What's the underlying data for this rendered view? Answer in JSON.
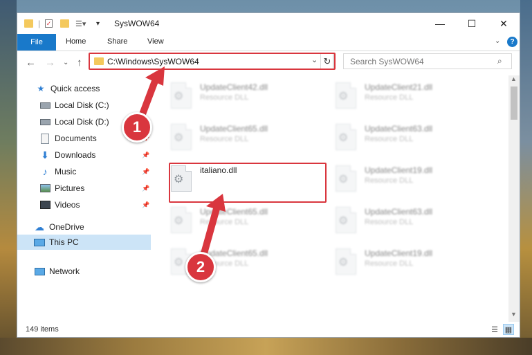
{
  "window": {
    "title": "SysWOW64",
    "controls": {
      "minimize": "—",
      "maximize": "☐",
      "close": "✕"
    }
  },
  "ribbon": {
    "file": "File",
    "tabs": [
      "Home",
      "Share",
      "View"
    ],
    "help": "?"
  },
  "address": {
    "path": "C:\\Windows\\SysWOW64",
    "search_placeholder": "Search SysWOW64"
  },
  "nav_pane": {
    "quick_access": "Quick access",
    "items": [
      {
        "label": "Local Disk (C:)",
        "icon": "drive-icon",
        "pinned": false
      },
      {
        "label": "Local Disk (D:)",
        "icon": "drive-icon",
        "pinned": false
      },
      {
        "label": "Documents",
        "icon": "documents-icon",
        "pinned": true
      },
      {
        "label": "Downloads",
        "icon": "downloads-icon",
        "pinned": true
      },
      {
        "label": "Music",
        "icon": "music-icon",
        "pinned": true
      },
      {
        "label": "Pictures",
        "icon": "pictures-icon",
        "pinned": true
      },
      {
        "label": "Videos",
        "icon": "videos-icon",
        "pinned": true
      }
    ],
    "onedrive": "OneDrive",
    "this_pc": "This PC",
    "network": "Network"
  },
  "files": {
    "left_col": [
      {
        "name": "UpdateClient42.dll",
        "type": "Resource DLL"
      },
      {
        "name": "UpdateClient65.dll",
        "type": "Resource DLL"
      },
      {
        "name": "italiano.dll",
        "type": ""
      },
      {
        "name": "UpdateClient65.dll",
        "type": "Resource DLL"
      },
      {
        "name": "UpdateClient65.dll",
        "type": "Resource DLL"
      }
    ],
    "right_col": [
      {
        "name": "UpdateClient21.dll",
        "type": "Resource DLL"
      },
      {
        "name": "UpdateClient63.dll",
        "type": "Resource DLL"
      },
      {
        "name": "UpdateClient19.dll",
        "type": "Resource DLL"
      },
      {
        "name": "UpdateClient63.dll",
        "type": "Resource DLL"
      },
      {
        "name": "UpdateClient19.dll",
        "type": "Resource DLL"
      }
    ]
  },
  "status": {
    "items": "149 items"
  },
  "annotations": {
    "marker1": "1",
    "marker2": "2"
  },
  "colors": {
    "accent": "#1979ca",
    "highlight": "#d9363e",
    "selected": "#cce4f7"
  }
}
